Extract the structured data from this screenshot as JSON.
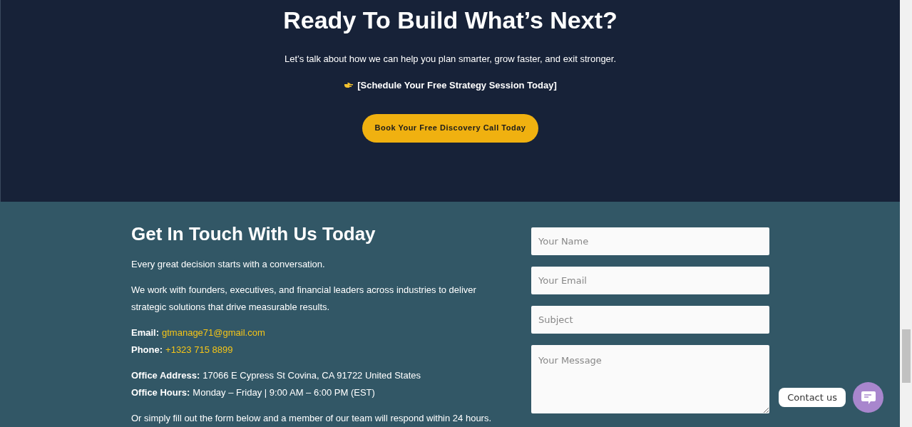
{
  "cta": {
    "title": "Ready To Build What’s Next?",
    "subtitle": "Let’s talk about how we can help you plan smarter, grow faster, and exit stronger.",
    "schedule_link": "[Schedule Your Free Strategy Session Today]",
    "button": "Book Your Free Discovery Call Today"
  },
  "contact": {
    "title": "Get In Touch With Us Today",
    "intro": "Every great decision starts with a conversation.",
    "description": "We work with founders, executives, and financial leaders across industries to deliver strategic solutions that drive measurable results.",
    "details": [
      {
        "kind": "link",
        "label": "Email:",
        "value": "gtmanage71@gmail.com"
      },
      {
        "kind": "link",
        "label": "Phone:",
        "value": "+1323 715 8899"
      },
      {
        "kind": "text",
        "label": "Office Address:",
        "value": "17066 E Cypress St Covina, CA 91722 United States"
      },
      {
        "kind": "text",
        "label": "Office Hours:",
        "value": "Monday – Friday | 9:00 AM – 6:00 PM (EST)"
      }
    ],
    "footer_note": "Or simply fill out the form below and a member of our team will respond within 24 hours."
  },
  "form": {
    "fields": [
      {
        "kind": "input",
        "placeholder": "Your Name"
      },
      {
        "kind": "input",
        "placeholder": "Your Email"
      },
      {
        "kind": "input",
        "placeholder": "Subject"
      },
      {
        "kind": "textarea",
        "placeholder": "Your Message"
      }
    ]
  },
  "chat_widget": {
    "label": "Contact us"
  }
}
